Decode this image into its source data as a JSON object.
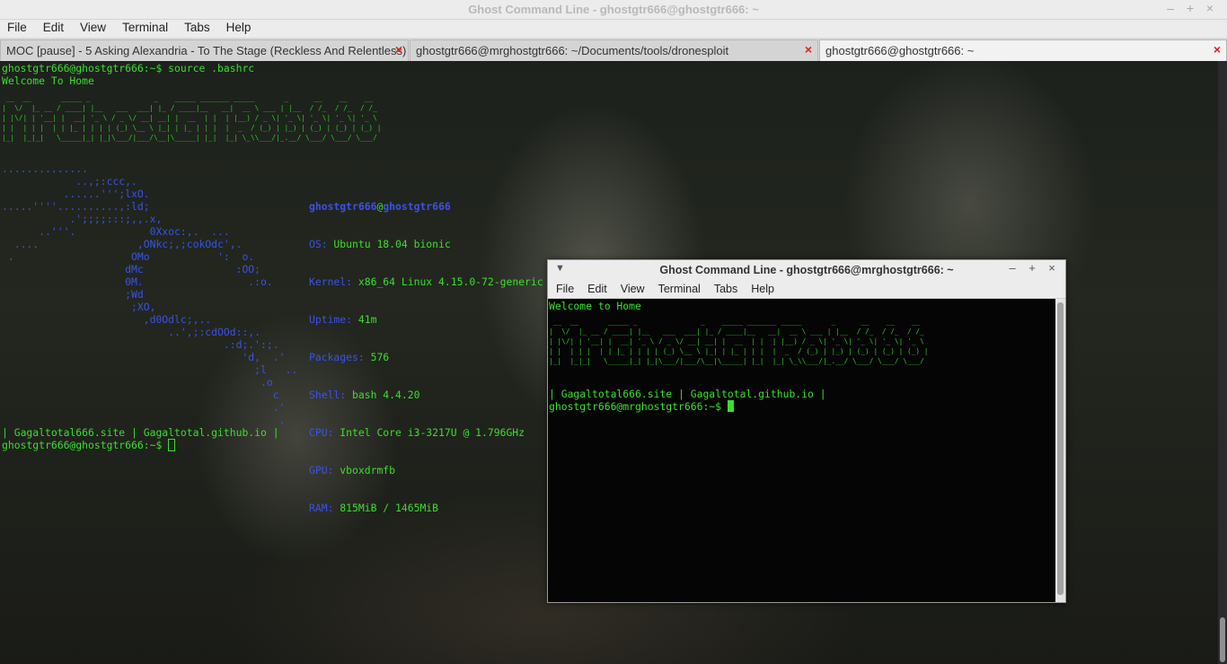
{
  "window": {
    "title": "Ghost Command Line - ghostgtr666@ghostgtr666: ~",
    "controls": {
      "minimize": "–",
      "maximize": "+",
      "close": "×"
    }
  },
  "menu": [
    "File",
    "Edit",
    "View",
    "Terminal",
    "Tabs",
    "Help"
  ],
  "tabs": [
    {
      "label": "MOC [pause] - 5 Asking Alexandria - To The Stage (Reckless And Relentless)",
      "close": "×"
    },
    {
      "label": "ghostgtr666@mrghostgtr666: ~/Documents/tools/dronesploit",
      "close": "×"
    },
    {
      "label": "ghostgtr666@ghostgtr666: ~",
      "close": "×"
    }
  ],
  "main_terminal": {
    "prompt_cmd": "ghostgtr666@ghostgtr666:~$ source .bashrc",
    "welcome": "Welcome To Home",
    "banner": [
      " __  __       _____ _               _    _____ _______ _____       _      __    __    __  ",
      "|  \\/  |_ __ / ____| |__   ___  ___| |_ / ____|__   __|  __ \\ ___ | |__  / /_  / /_  / /_ ",
      "| |\\/| | '__| |  __| '_ \\ / _ \\/ __| __| |  __  | |  | |__) / _ \\| '_ \\| '_ \\| '_ \\| '_ \\",
      "| |  | | |  | | |_ | | | | (_) \\__ \\ |_| | |_ | | |  |  _  / (_) | |_) | (_) | (_) | (_) |",
      "|_|  |_|_|   \\_____|_| |_|\\___/|___/\\__|\\_____| |_|  |_| \\_\\\\___/|_.__/ \\___/ \\___/ \\___/ "
    ],
    "logo": [
      "..............",
      "            ..,;:ccc,.",
      "          ......''';lxO.",
      ".....''''..........,:ld;",
      "           .';;;;:::;,,.x,",
      "      ..'''.            0Xxoc:,.  ...",
      "  ....                ,ONkc;,;cokOdc',.",
      " .                   OMo           ':  o.",
      "                    dMc               :OO;",
      "                    0M.                 .:o.",
      "                    ;Wd",
      "                     ;XO,",
      "                       ,d0Odlc;,..",
      "                           ..',;:cdOOd::,.",
      "                                    .:d;.':;.",
      "                                       'd,  .'",
      "                                         ;l   ..",
      "                                          .o",
      "                                            c",
      "                                            .'",
      "                                             ."
    ],
    "info_user": "ghostgtr666",
    "info_at": "@",
    "info_host": "ghostgtr666",
    "info": [
      {
        "k": "OS:",
        "v": " Ubuntu 18.04 bionic"
      },
      {
        "k": "Kernel:",
        "v": " x86_64 Linux 4.15.0-72-generic"
      },
      {
        "k": "Uptime:",
        "v": " 41m"
      },
      {
        "k": "Packages:",
        "v": " 576"
      },
      {
        "k": "Shell:",
        "v": " bash 4.4.20"
      },
      {
        "k": "CPU:",
        "v": " Intel Core i3-3217U @ 1.796GHz"
      },
      {
        "k": "GPU:",
        "v": " vboxdrmfb"
      },
      {
        "k": "RAM:",
        "v": " 815MiB / 1465MiB"
      }
    ],
    "links": "| Gagaltotal666.site | Gagaltotal.github.io |",
    "prompt": "ghostgtr666@ghostgtr666:~$ "
  },
  "second_window": {
    "title": "Ghost Command Line - ghostgtr666@mrghostgtr666: ~",
    "menu_icon": "▼",
    "controls": {
      "minimize": "–",
      "maximize": "+",
      "close": "×"
    },
    "menu": [
      "File",
      "Edit",
      "View",
      "Terminal",
      "Tabs",
      "Help"
    ],
    "welcome": "Welcome to Home",
    "links": "| Gagaltotal666.site | Gagaltotal.github.io |",
    "prompt": "ghostgtr666@mrghostgtr666:~$ "
  }
}
